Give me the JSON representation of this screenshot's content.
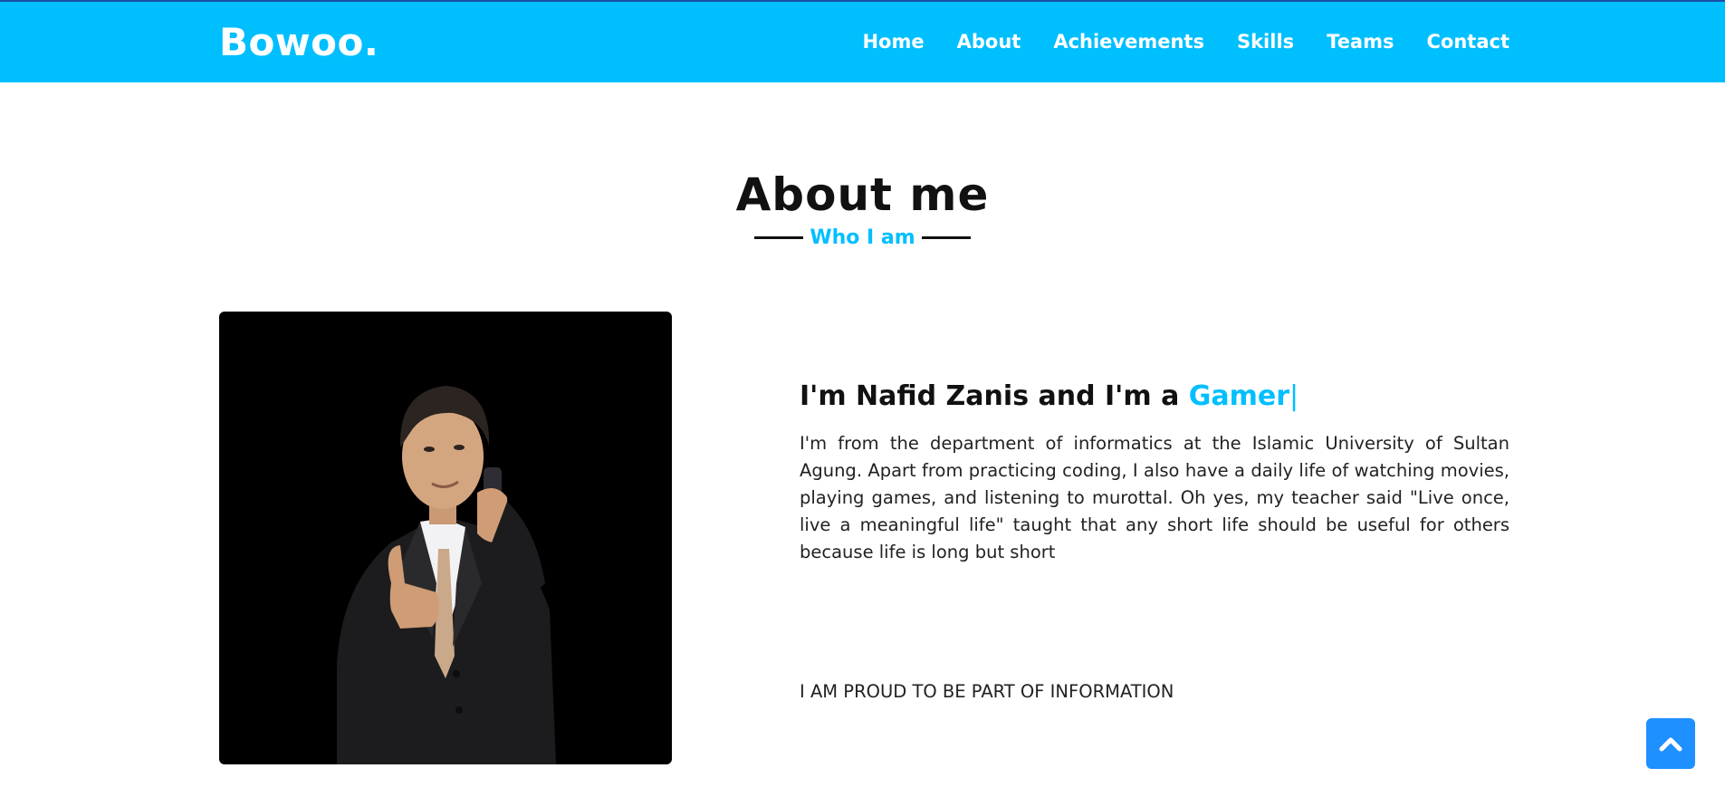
{
  "header": {
    "logo": "Bowoo.",
    "nav": [
      {
        "label": "Home"
      },
      {
        "label": "About"
      },
      {
        "label": "Achievements"
      },
      {
        "label": "Skills"
      },
      {
        "label": "Teams"
      },
      {
        "label": "Contact"
      }
    ]
  },
  "about": {
    "title": "About me",
    "subtitle": "Who I am",
    "intro": "I'm Nafid Zanis and I'm a ",
    "role": "Gamer",
    "cursor": "|",
    "description": "I'm from the department of informatics at the Islamic University of Sultan Agung. Apart from practicing coding, I also have a daily life of watching movies, playing games, and listening to murottal. Oh yes, my teacher said \"Live once, live a meaningful life\" taught that any short life should be useful for others because life is long but short",
    "proud": "I AM PROUD TO BE PART OF INFORMATION"
  },
  "colors": {
    "accent": "#00bfff",
    "navbar": "#00bfff",
    "back_to_top": "#1e90ff",
    "photo_background": "#000000"
  },
  "icons": {
    "back_to_top": "chevron-up-icon"
  }
}
